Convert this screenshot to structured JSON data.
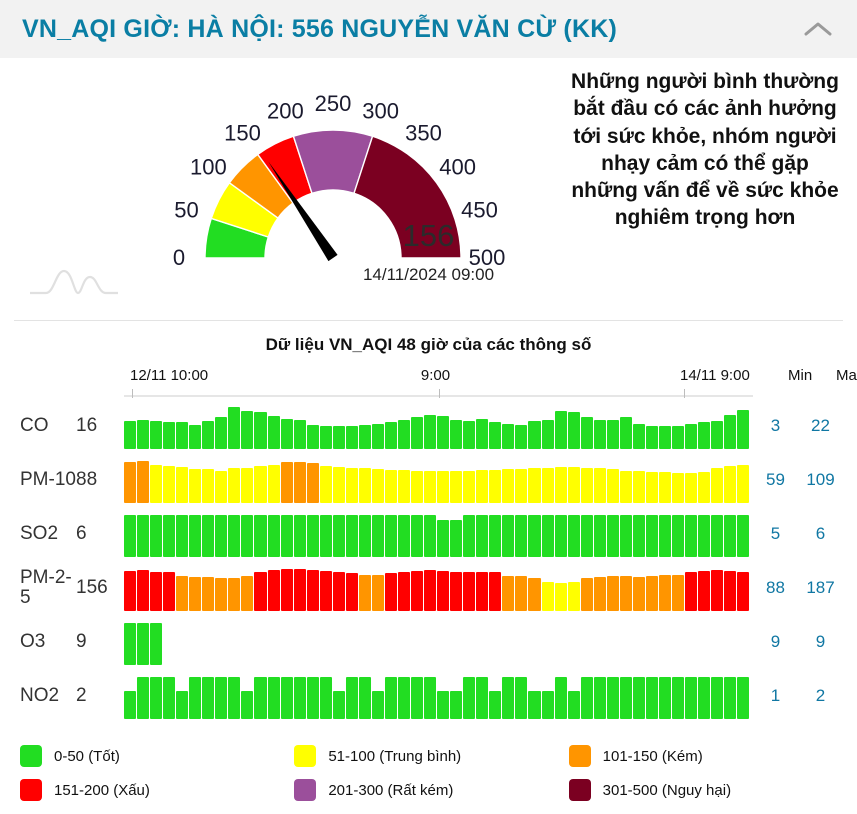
{
  "header": {
    "title": "VN_AQI GIỜ: HÀ NỘI: 556 NGUYỄN VĂN CỪ (KK)",
    "collapse_icon": "chevron-up-icon",
    "title_color": "#0a7ea4",
    "background": "#f2f2f2"
  },
  "gauge": {
    "value": "156",
    "value_number": 156,
    "timestamp": "14/11/2024 09:00",
    "min": 0,
    "max": 500,
    "tick_labels": [
      "0",
      "50",
      "100",
      "150",
      "200",
      "250",
      "300",
      "350",
      "400",
      "450",
      "500"
    ],
    "segments": [
      {
        "from": 0,
        "to": 50,
        "color": "#22dd22"
      },
      {
        "from": 50,
        "to": 100,
        "color": "#ffff00"
      },
      {
        "from": 100,
        "to": 150,
        "color": "#ff9500"
      },
      {
        "from": 150,
        "to": 200,
        "color": "#ff0000"
      },
      {
        "from": 200,
        "to": 300,
        "color": "#9b4f9b"
      },
      {
        "from": 300,
        "to": 500,
        "color": "#7b0021"
      }
    ],
    "needle_color": "#000000",
    "advice": "Những người bình thường bắt đầu có các ảnh hưởng tới sức khỏe, nhóm người nhạy cảm có thể gặp những vấn để về sức khỏe nghiêm trọng hơn",
    "wave_icon": "distribution-curve-icon"
  },
  "chart": {
    "title": "Dữ liệu VN_AQI 48 giờ của các thông số",
    "axis": {
      "left": "12/11 10:00",
      "middle": "9:00",
      "right": "14/11 9:00",
      "min_header": "Min",
      "max_header": "Max"
    }
  },
  "chart_data": {
    "type": "bar",
    "title": "Dữ liệu VN_AQI 48 giờ của các thông số",
    "xlabel": "",
    "ylabel": "VN_AQI",
    "x_ticks": [
      "12/11 10:00",
      "9:00",
      "14/11 9:00"
    ],
    "n_points": 48,
    "color_scale": [
      {
        "range": "0-50",
        "color": "#22dd22"
      },
      {
        "range": "51-100",
        "color": "#ffff00"
      },
      {
        "range": "101-150",
        "color": "#ff9500"
      },
      {
        "range": "151-200",
        "color": "#ff0000"
      },
      {
        "range": "201-300",
        "color": "#9b4f9b"
      },
      {
        "range": "301-500",
        "color": "#7b0021"
      }
    ],
    "series": [
      {
        "name": "CO",
        "current": "16",
        "min": "3",
        "max": "22",
        "values": [
          11,
          12,
          11,
          10,
          10,
          8,
          11,
          14,
          22,
          19,
          18,
          15,
          13,
          12,
          8,
          7,
          7,
          7,
          8,
          9,
          10,
          12,
          14,
          16,
          15,
          12,
          11,
          13,
          10,
          9,
          8,
          11,
          12,
          19,
          18,
          14,
          12,
          12,
          14,
          9,
          7,
          7,
          7,
          9,
          10,
          11,
          16,
          20
        ]
      },
      {
        "name": "PM-10",
        "current": "88",
        "min": "59",
        "max": "109",
        "values": [
          105,
          109,
          95,
          88,
          85,
          78,
          77,
          72,
          80,
          82,
          88,
          95,
          104,
          106,
          103,
          88,
          85,
          83,
          80,
          78,
          76,
          74,
          72,
          70,
          69,
          70,
          72,
          74,
          75,
          77,
          78,
          80,
          82,
          84,
          85,
          83,
          80,
          78,
          72,
          70,
          68,
          66,
          64,
          62,
          68,
          80,
          90,
          95
        ]
      },
      {
        "name": "SO2",
        "current": "6",
        "min": "5",
        "max": "6",
        "values": [
          6,
          6,
          6,
          6,
          6,
          6,
          6,
          6,
          6,
          6,
          6,
          6,
          6,
          6,
          6,
          6,
          6,
          6,
          6,
          6,
          6,
          6,
          6,
          6,
          5,
          5,
          6,
          6,
          6,
          6,
          6,
          6,
          6,
          6,
          6,
          6,
          6,
          6,
          6,
          6,
          6,
          6,
          6,
          6,
          6,
          6,
          6,
          6
        ]
      },
      {
        "name": "PM-2-5",
        "current": "156",
        "min": "88",
        "max": "187",
        "values": [
          176,
          181,
          170,
          166,
          140,
          133,
          134,
          124,
          128,
          143,
          168,
          178,
          185,
          187,
          180,
          172,
          168,
          160,
          148,
          150,
          162,
          170,
          176,
          178,
          172,
          168,
          165,
          170,
          168,
          140,
          138,
          130,
          98,
          96,
          98,
          128,
          134,
          140,
          138,
          136,
          142,
          145,
          148,
          170,
          176,
          178,
          174,
          170
        ]
      },
      {
        "name": "O3",
        "current": "9",
        "min": "9",
        "max": "9",
        "values": [
          9,
          9,
          9,
          null,
          null,
          null,
          null,
          null,
          null,
          null,
          null,
          null,
          null,
          null,
          null,
          null,
          null,
          null,
          null,
          null,
          null,
          null,
          null,
          null,
          null,
          null,
          null,
          null,
          null,
          null,
          null,
          null,
          null,
          null,
          null,
          null,
          null,
          null,
          null,
          null,
          null,
          null,
          null,
          null,
          null,
          null,
          null,
          null
        ]
      },
      {
        "name": "NO2",
        "current": "2",
        "min": "1",
        "max": "2",
        "values": [
          1,
          2,
          2,
          2,
          1,
          2,
          2,
          2,
          2,
          1,
          2,
          2,
          2,
          2,
          2,
          2,
          1,
          2,
          2,
          1,
          2,
          2,
          2,
          2,
          1,
          1,
          2,
          2,
          1,
          2,
          2,
          1,
          1,
          2,
          1,
          2,
          2,
          2,
          2,
          2,
          2,
          2,
          2,
          2,
          2,
          2,
          2,
          2
        ]
      }
    ]
  },
  "legend": {
    "items": [
      {
        "label": "0-50 (Tốt)",
        "color": "#22dd22"
      },
      {
        "label": "51-100 (Trung bình)",
        "color": "#ffff00"
      },
      {
        "label": "101-150 (Kém)",
        "color": "#ff9500"
      },
      {
        "label": "151-200 (Xấu)",
        "color": "#ff0000"
      },
      {
        "label": "201-300 (Rất kém)",
        "color": "#9b4f9b"
      },
      {
        "label": "301-500 (Nguy hại)",
        "color": "#7b0021"
      }
    ]
  }
}
